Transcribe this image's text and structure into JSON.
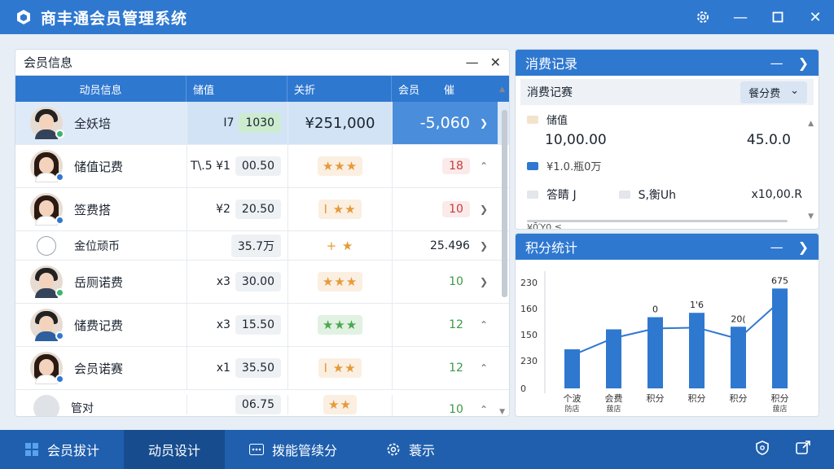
{
  "window": {
    "title": "商丰通会员管理系统"
  },
  "member_panel": {
    "title": "会员信息",
    "columns": [
      "动员信息",
      "储值",
      "关折",
      "会员",
      "催"
    ],
    "rows": [
      {
        "name": "全妖培",
        "prefix": "I7",
        "balance": "1030",
        "col3": "¥251,000",
        "col4": "-5,060"
      },
      {
        "name": "储值记费",
        "prefix": "T\\.5 ¥1",
        "balance": "00.50",
        "stars": "★★★",
        "count": "18"
      },
      {
        "name": "签费搭",
        "prefix": "¥2",
        "balance": "20.50",
        "stars": "I ★★",
        "count": "10"
      },
      {
        "name": "金位顽币",
        "balance": "35.7万",
        "stars": "+ ★",
        "amount": "25.496"
      },
      {
        "name": "岳厕诺费",
        "prefix": "x3",
        "balance": "30.00",
        "stars": "★★★",
        "count": "10"
      },
      {
        "name": "储费记费",
        "prefix": "x3",
        "balance": "15.50",
        "stars": "★★★",
        "count": "12"
      },
      {
        "name": "会员诺赛",
        "prefix": "x1",
        "balance": "35.50",
        "stars": "I ★★",
        "count": "12"
      },
      {
        "name": "管对",
        "balance": "06.75",
        "stars": "★★",
        "count": "10"
      }
    ]
  },
  "consume_panel": {
    "title": "消费记录",
    "sub_title": "消费记赛",
    "dropdown": "餐分费",
    "legend1": "储值",
    "value_left": "10,00.00",
    "value_right": "45.0.0",
    "legend2": "¥1.0.瓶0万",
    "item1": "答睛 J",
    "item2": "S,衡Uh",
    "item3": "x10,00.R",
    "cut": "¥0̄Ύ0 ≦"
  },
  "points_panel": {
    "title": "积分统计"
  },
  "chart_data": {
    "type": "bar",
    "title": "",
    "xlabel": "",
    "ylabel": "",
    "y_ticks": [
      "230",
      "160",
      "150",
      "230",
      "0"
    ],
    "categories": [
      "个波 防店",
      "会费 菝店",
      "积分",
      "积分",
      "积分",
      "积分 菝店"
    ],
    "values": [
      45,
      68,
      82,
      87,
      71,
      115
    ],
    "line_values": [
      38,
      58,
      69,
      70,
      57,
      100
    ],
    "labels": [
      "",
      "",
      "0",
      "1'6",
      "20(",
      "675"
    ],
    "ylim": [
      0,
      135
    ]
  },
  "nav": {
    "item1": "会员拔计",
    "item2": "动员设计",
    "item3": "拨能管续分",
    "item4": "蓑示"
  },
  "colors": {
    "primary": "#2f78d0",
    "nav": "#1f5fae",
    "star": "#e59a3a"
  }
}
